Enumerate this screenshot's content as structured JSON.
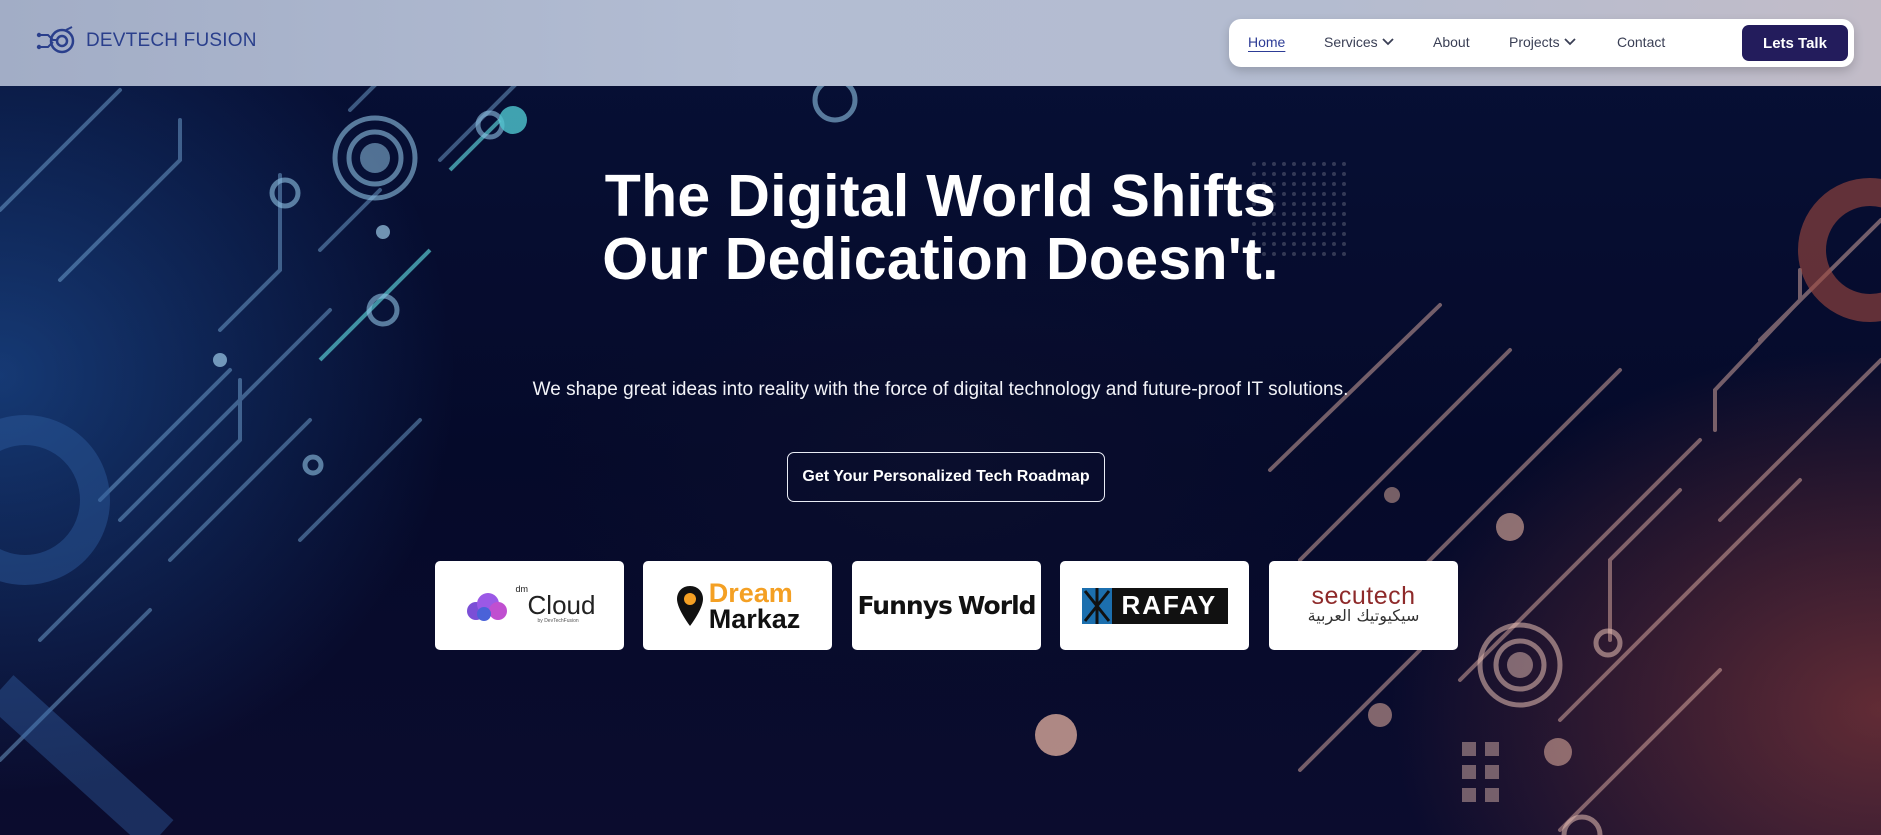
{
  "brand": {
    "name": "DEVTECH FUSION"
  },
  "nav": {
    "items": [
      {
        "label": "Home",
        "active": true
      },
      {
        "label": "Services",
        "dropdown": true
      },
      {
        "label": "About"
      },
      {
        "label": "Projects",
        "dropdown": true
      },
      {
        "label": "Contact"
      }
    ],
    "cta": "Lets Talk"
  },
  "hero": {
    "headline_line1": "The Digital World Shifts",
    "headline_line2": "Our Dedication Doesn't.",
    "subtitle": "We shape great ideas into reality with the force of digital technology and future-proof IT solutions.",
    "cta": "Get Your Personalized Tech Roadmap"
  },
  "clients": [
    {
      "name": "dm Cloud",
      "prefix": "dm",
      "word": "Cloud",
      "tagline": "by DevTechFusion"
    },
    {
      "name": "Dream Markaz",
      "line1": "Dream",
      "line2": "Markaz"
    },
    {
      "name": "Funnys World",
      "word1": "Funnys",
      "word2": "World"
    },
    {
      "name": "RAFAY",
      "word": "RAFAY"
    },
    {
      "name": "secutech",
      "word": "secutech",
      "arabic": "سيكيوتيك العربية"
    }
  ],
  "colors": {
    "brand_navy": "#231c5c",
    "logo_blue": "#2a3f8c",
    "dream_orange": "#f4a024"
  }
}
